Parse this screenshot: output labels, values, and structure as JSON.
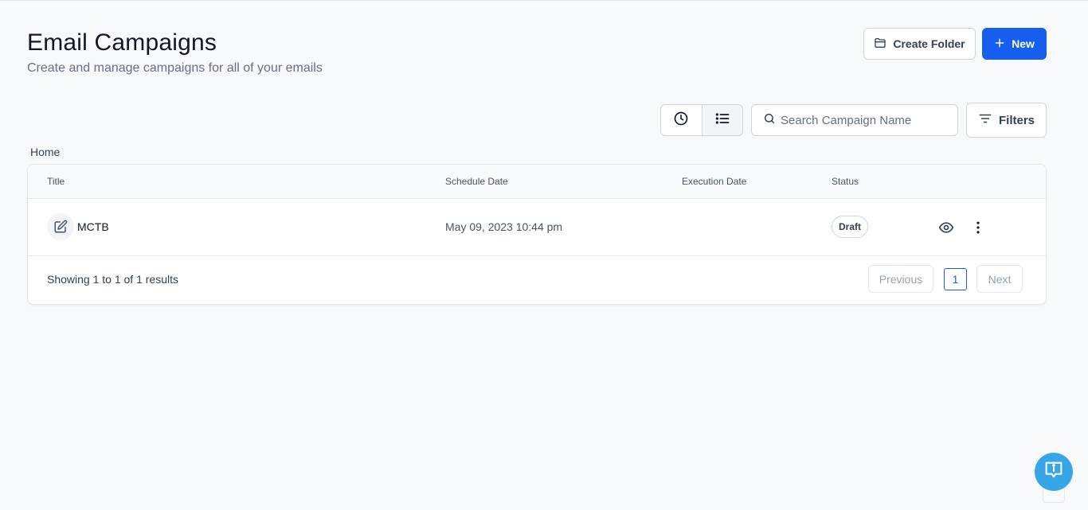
{
  "header": {
    "title": "Email Campaigns",
    "subtitle": "Create and manage campaigns for all of your emails",
    "create_folder_label": "Create Folder",
    "new_label": "New"
  },
  "toolbar": {
    "search_placeholder": "Search Campaign Name",
    "filters_label": "Filters"
  },
  "breadcrumb": "Home",
  "table": {
    "columns": [
      "Title",
      "Schedule Date",
      "Execution Date",
      "Status"
    ],
    "rows": [
      {
        "title": "MCTB",
        "schedule_date": "May 09, 2023 10:44 pm",
        "execution_date": "",
        "status": "Draft"
      }
    ]
  },
  "pagination": {
    "summary": "Showing 1 to 1 of 1 results",
    "previous_label": "Previous",
    "current_page": "1",
    "next_label": "Next"
  },
  "colors": {
    "primary": "#155eef",
    "help_button": "#37a6e8"
  }
}
